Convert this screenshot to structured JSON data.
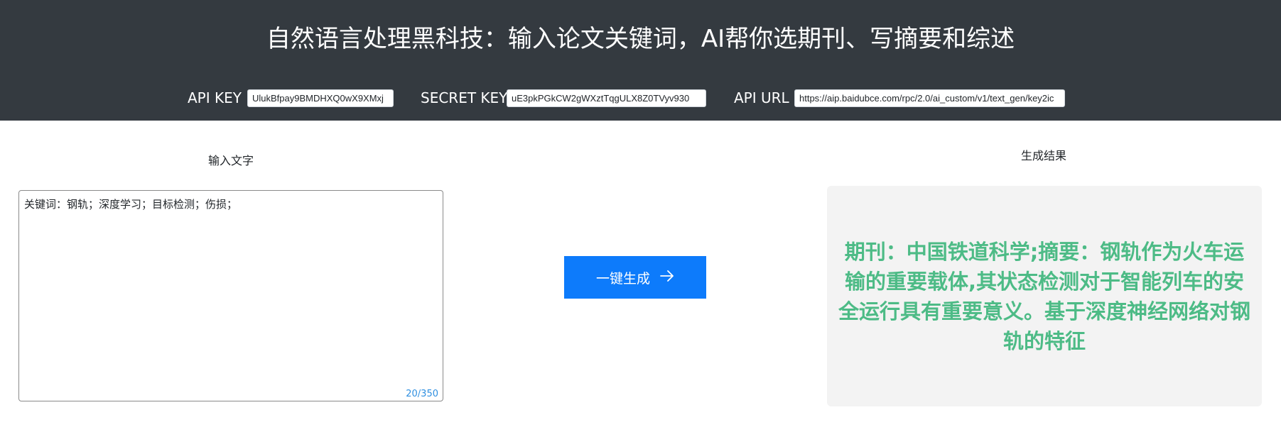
{
  "header": {
    "title": "自然语言处理黑科技：输入论文关键词，AI帮你选期刊、写摘要和综述",
    "api_key_label": "API KEY",
    "api_key_value": "UlukBfpay9BMDHXQ0wX9XMxj",
    "secret_key_label": "SECRET KEY",
    "secret_key_value": "uE3pkPGkCW2gWXztTqgULX8Z0TVyv930",
    "api_url_label": "API URL",
    "api_url_value": "https://aip.baidubce.com/rpc/2.0/ai_custom/v1/text_gen/key2ic"
  },
  "input_section": {
    "label": "输入文字",
    "value": "关键词：钢轨；深度学习；目标检测；伤损；",
    "counter": "20/350"
  },
  "action": {
    "generate_label": "一键生成",
    "arrow_icon": "arrow-right-icon"
  },
  "result_section": {
    "label": "生成结果",
    "text": "期刊：中国铁道科学;摘要：钢轨作为火车运输的重要载体,其状态检测对于智能列车的安全运行具有重要意义。基于深度神经网络对钢轨的特征"
  },
  "colors": {
    "header_bg": "#343a40",
    "button_bg": "#0d7bfb",
    "result_text": "#4dbb86",
    "result_bg": "#f3f3f3",
    "counter_text": "#2f8fe0"
  }
}
